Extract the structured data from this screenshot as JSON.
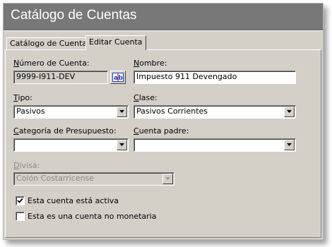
{
  "window": {
    "title": "Catálogo de Cuentas"
  },
  "tabs": [
    {
      "label": "Catálogo de Cuentas",
      "active": false
    },
    {
      "label": "Editar Cuenta",
      "active": true
    }
  ],
  "form": {
    "account_number": {
      "label_mnemonic": "N",
      "label_rest": "úmero de Cuenta:",
      "value": "9999-I911-DEV"
    },
    "name": {
      "label_mnemonic": "N",
      "label_rest": "ombre:",
      "value": "Impuesto 911 Devengado"
    },
    "type": {
      "label_mnemonic": "T",
      "label_rest": "ipo:",
      "value": "Pasivos"
    },
    "class": {
      "label_mnemonic": "C",
      "label_rest": "lase:",
      "value": "Pasivos Corrientes"
    },
    "budget_category": {
      "label_mnemonic": "C",
      "label_rest": "ategoría de Presupuesto:",
      "value": ""
    },
    "parent_account": {
      "label_mnemonic": "C",
      "label_rest": "uenta padre:",
      "value": ""
    },
    "currency": {
      "label_mnemonic": "D",
      "label_rest": "ivisa:",
      "value": "Colón Costarricense"
    },
    "active_checkbox": {
      "label": "Esta cuenta está activa",
      "checked": true
    },
    "nonmonetary_checkbox": {
      "label": "Esta es una cuenta no monetaria",
      "checked": false
    }
  },
  "icons": {
    "edit_name_button": "ab-rename-icon",
    "dropdown": "chevron-down-icon",
    "checkmark": "checkmark-icon"
  },
  "colors": {
    "title_bar": "#787878",
    "dialog_face": "#d4d0c8",
    "rename_icon_blue": "#1f3fbf"
  }
}
